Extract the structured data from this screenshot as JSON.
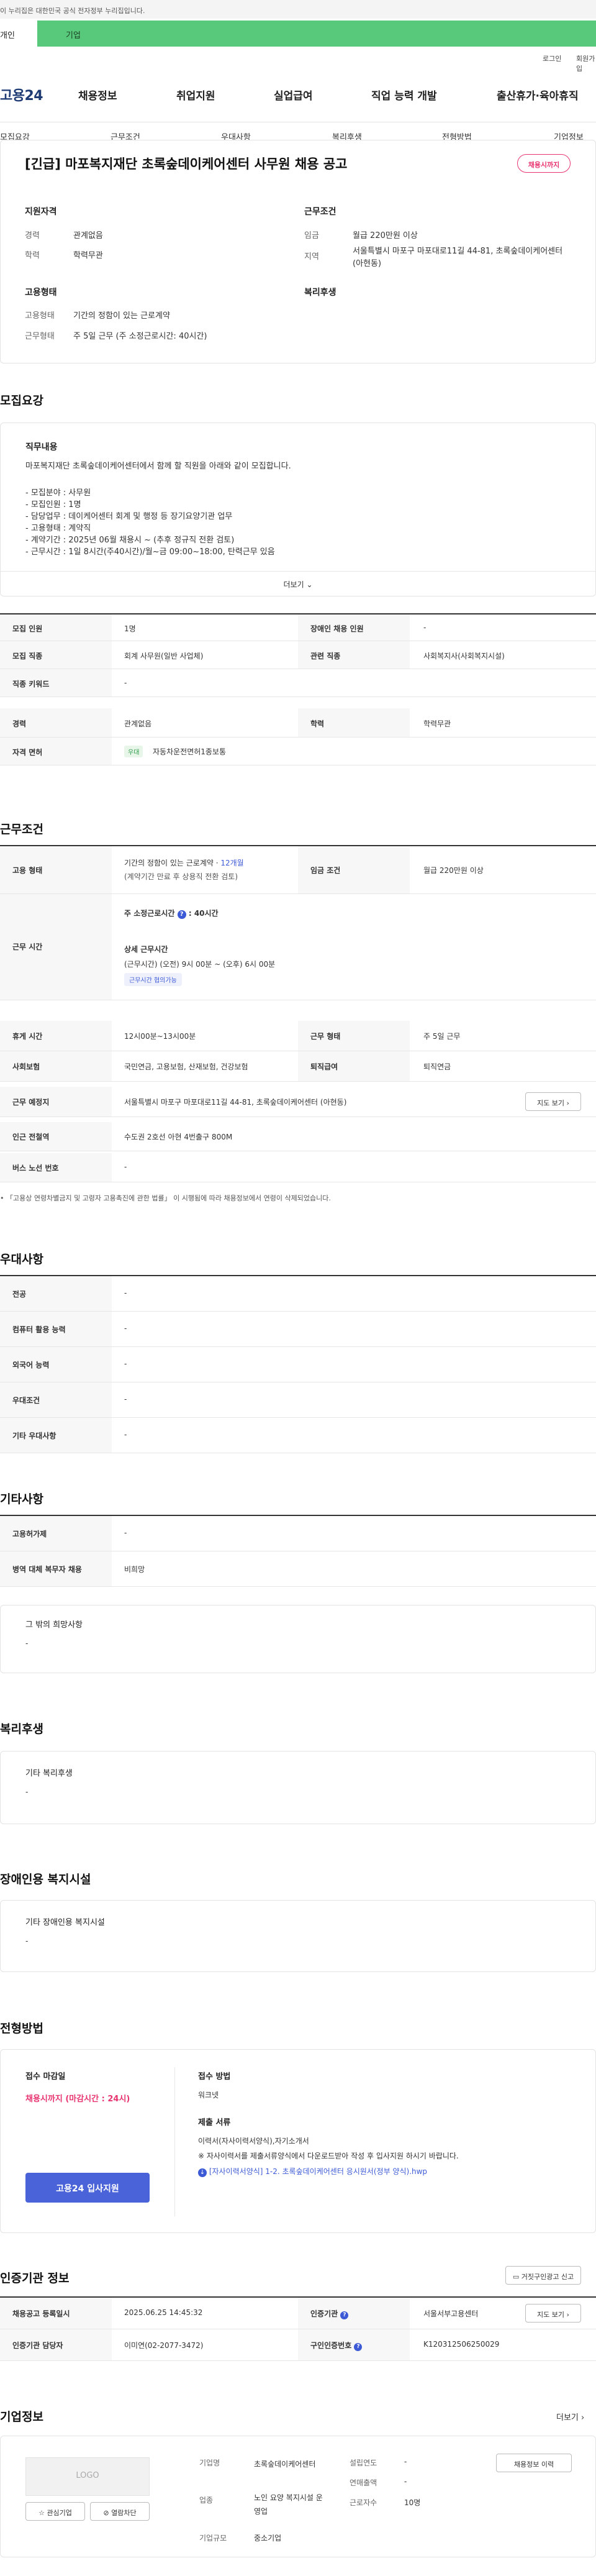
{
  "gov_notice": "이 누리집은 대한민국 공식 전자정부 누리집입니다.",
  "top_tabs": {
    "person": "개인",
    "company": "기업"
  },
  "util": {
    "login": "로그인",
    "join": "회원가입"
  },
  "logo": "고용24",
  "gnb": [
    "채용정보",
    "취업지원",
    "실업급여",
    "직업 능력 개발",
    "출산휴가·육아휴직"
  ],
  "subnav": [
    "모집요강",
    "근무조건",
    "우대사항",
    "복리후생",
    "전형방법",
    "기업정보"
  ],
  "job": {
    "title": "[긴급] 마포복지재단 초록숲데이케어센터 사무원 채용 공고",
    "status_badge": "채용시까지",
    "qualifications_heading": "지원자격",
    "career_label": "경력",
    "career_value": "관계없음",
    "edu_label": "학력",
    "edu_value": "학력무관",
    "conditions_heading": "근무조건",
    "wage_label": "임금",
    "wage_value": "월급 220만원 이상",
    "region_label": "지역",
    "region_value": "서울특별시 마포구 마포대로11길 44-81, 초록숲데이케어센터 (아현동)",
    "employment_heading": "고용형태",
    "emp_type_label": "고용형태",
    "emp_type_value": "기간의 정함이 있는 근로계약",
    "work_form_label": "근무형태",
    "work_form_value": "주 5일 근무 (주 소정근로시간: 40시간)",
    "welfare_heading": "복리후생"
  },
  "recruit": {
    "section_title": "모집요강",
    "duty_heading": "직무내용",
    "duty_lines": [
      "마포복지재단 초록숲데이케어센터에서 함께 할 직원을 아래와 같이 모집합니다.",
      "",
      "- 모집분야 : 사무원",
      "- 모집인원 : 1명",
      "- 담당업무 : 데이케어센터 회계 및 행정 등 장기요양기관 업무",
      "- 고용형태 : 계약직",
      "- 계약기간 : 2025년 06월 채용시 ~  (추후 정규직 전환 검토)",
      "- 근무시간 : 1일 8시간(주40시간)/월~금 09:00~18:00, 탄력근무 있음"
    ],
    "more_label": "더보기",
    "rows": [
      {
        "l1": "모집 인원",
        "v1": "1명",
        "l2": "장애인 채용 인원",
        "v2": "-"
      },
      {
        "l1": "모집 직종",
        "v1": "회계 사무원(일반 사업체)",
        "l2": "관련 직종",
        "v2": "사회복지사(사회복지시설)"
      },
      {
        "l1": "직종 키워드",
        "v1": "-",
        "l2": "",
        "v2": ""
      },
      {
        "l1": "경력",
        "v1": "관계없음",
        "l2": "학력",
        "v2": "학력무관"
      },
      {
        "l1": "자격 면허",
        "v1": "자동차운전면허1종보통",
        "l2": "",
        "v2": ""
      }
    ],
    "license_tag": "우대"
  },
  "conditions": {
    "section_title": "근무조건",
    "emp_type_label": "고용 형태",
    "emp_type_value": "기간의 정함이 있는 근로계약 · ",
    "emp_type_months": "12개월",
    "emp_type_note": "(계약기간 만료 후 상용직 전환 검토)",
    "wage_label": "임금 조건",
    "wage_value": "월급 220만원 이상",
    "hours_label": "근무 시간",
    "weekly_hours": "주 소정근로시간",
    "weekly_hours_value": ": 40시간",
    "detail_heading": "상세 근무시간",
    "detail_value": "(근무시간) (오전) 9시 00분 ~ (오후) 6시 00분",
    "flex_tag": "근무시간 협의가능",
    "break_label": "휴게 시간",
    "break_value": "12시00분~13시00분",
    "work_form_label": "근무 형태",
    "work_form_value": "주 5일 근무",
    "insurance_label": "사회보험",
    "insurance_value": "국민연금, 고용보험, 산재보험, 건강보험",
    "retire_label": "퇴직급여",
    "retire_value": "퇴직연금",
    "place_label": "근무 예정지",
    "place_value": "서울특별시 마포구 마포대로11길 44-81, 초록숲데이케어센터 (아현동)",
    "map_btn": "지도 보기",
    "subway_label": "인근 전철역",
    "subway_value": "수도권 2호선 아현 4번출구 800M",
    "bus_label": "버스 노선 번호",
    "bus_value": "-",
    "footnote": "「고용상 연령차별금지 및 고령자 고용촉진에 관한 법률」 이 시행됨에 따라 채용정보에서 연령이 삭제되었습니다."
  },
  "preferred": {
    "section_title": "우대사항",
    "rows": [
      {
        "label": "전공",
        "value": "-"
      },
      {
        "label": "컴퓨터 활용 능력",
        "value": "-"
      },
      {
        "label": "외국어 능력",
        "value": "-"
      },
      {
        "label": "우대조건",
        "value": "-"
      },
      {
        "label": "기타 우대사항",
        "value": "-"
      }
    ]
  },
  "other": {
    "section_title": "기타사항",
    "rows": [
      {
        "label": "고용허가제",
        "value": "-"
      },
      {
        "label": "병역 대체 복무자 채용",
        "value": "비희망"
      }
    ],
    "etc_heading": "그 밖의 희망사항",
    "etc_value": "-"
  },
  "welfare": {
    "section_title": "복리후생",
    "heading": "기타 복리후생",
    "value": "-"
  },
  "disability": {
    "section_title": "장애인용 복지시설",
    "heading": "기타 장애인용 복지시설",
    "value": "-"
  },
  "selection": {
    "section_title": "전형방법",
    "deadline_label": "접수 마감일",
    "deadline_value": "채용시까지 (마감시간 : 24시)",
    "apply_btn": "고용24 입사지원",
    "method_label": "접수 방법",
    "method_value": "워크넷",
    "docs_label": "제출 서류",
    "docs_value": "이력서(자사이력서양식),자기소개서",
    "docs_note": "※ 자사이력서를 제출서류양식에서 다운로드받아 작성 후 입사지원 하시기 바랍니다.",
    "file_link": "[자사이력서양식] 1-2. 초록숲데이케어센터 응시원서(정부 양식).hwp"
  },
  "cert": {
    "section_title": "인증기관 정보",
    "report_btn": "거짓구인광고 신고",
    "reg_date_label": "채용공고 등록일시",
    "reg_date_value": "2025.06.25 14:45:32",
    "cert_org_label": "인증기관",
    "cert_org_value": "서울서부고용센터",
    "map_btn": "지도 보기",
    "manager_label": "인증기관 담당자",
    "manager_value": "이미연(02-2077-3472)",
    "cert_no_label": "구인인증번호",
    "cert_no_value": "K120312506250029"
  },
  "company": {
    "section_title": "기업정보",
    "more_label": "더보기",
    "logo_text": "LOGO",
    "fav_btn": "관심기업",
    "block_btn": "열람차단",
    "name_label": "기업명",
    "name_value": "초록숲데이케어센터",
    "industry_label": "업종",
    "industry_value": "노인 요양 복지시설 운영업",
    "size_label": "기업규모",
    "size_value": "중소기업",
    "founded_label": "설립연도",
    "founded_value": "-",
    "revenue_label": "연매출액",
    "revenue_value": "-",
    "employees_label": "근로자수",
    "employees_value": "10명",
    "history_btn": "채용정보 이력"
  }
}
